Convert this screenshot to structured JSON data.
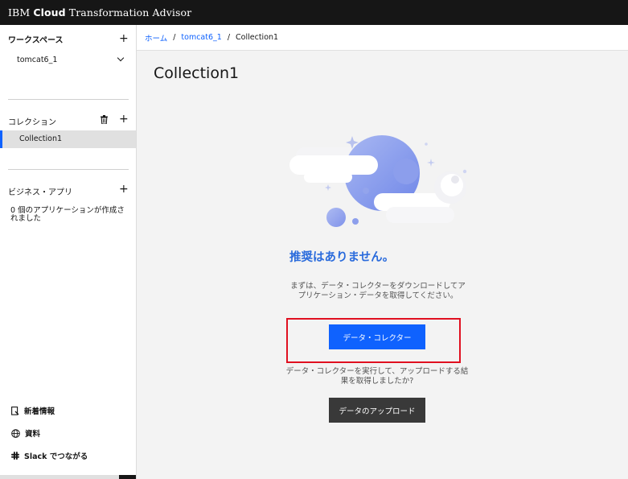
{
  "header": {
    "brand_prefix": "IBM",
    "brand_bold": "Cloud",
    "brand_suffix": "Transformation Advisor"
  },
  "sidebar": {
    "workspace_heading": "ワークスペース",
    "workspace_item": "tomcat6_1",
    "collection_heading": "コレクション",
    "collection_item": "Collection1",
    "business_apps_heading": "ビジネス・アプリ",
    "business_apps_empty": "0 個のアプリケーションが作成されました",
    "footer": {
      "whats_new": "新着情報",
      "resources": "資料",
      "slack": "Slack でつながる"
    }
  },
  "breadcrumb": {
    "home": "ホーム",
    "workspace": "tomcat6_1",
    "current": "Collection1"
  },
  "main": {
    "title": "Collection1",
    "empty_title": "推奨はありません。",
    "empty_description": "まずは、データ・コレクターをダウンロードしてアプリケーション・データを取得してください。",
    "data_collector_button": "データ・コレクター",
    "upload_description": "データ・コレクターを実行して、アップロードする結果を取得しましたか?",
    "upload_button": "データのアップロード"
  },
  "colors": {
    "primary": "#0f62fe",
    "highlight": "#e01020",
    "title_blue": "#2a6bdc"
  }
}
